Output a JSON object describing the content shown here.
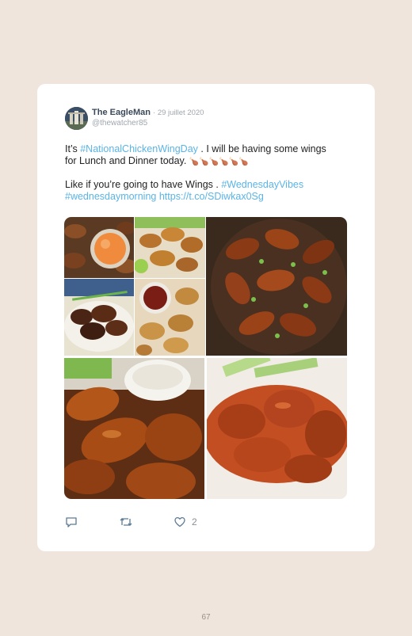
{
  "tweet": {
    "author_name": "The EagleMan",
    "date": "· 29 juillet 2020",
    "handle": "@thewatcher85",
    "line1_prefix": "It’s ",
    "line1_hashtag": "#NationalChickenWingDay",
    "line1_suffix": " . I will be having some wings",
    "line2": "for Lunch and Dinner today.",
    "line2_emoji": "🍗🍗🍗🍗🍗🍗",
    "line3_prefix": "Like if you’re going to have Wings . ",
    "line3_hashtag": "#WednesdayVibes",
    "line4_hashtag": "#wednesdaymorning",
    "line4_link": "https://t.co/SDiwkax0Sg",
    "like_count": "2"
  },
  "media": [
    {
      "name": "wings-with-dip-small-1"
    },
    {
      "name": "fried-wings-small-2"
    },
    {
      "name": "glazed-wings-skillet"
    },
    {
      "name": "wings-on-plate-small-3"
    },
    {
      "name": "wings-with-sauce-small-4"
    },
    {
      "name": "honey-glazed-wings-with-ranch"
    },
    {
      "name": "buffalo-wings-with-celery"
    }
  ],
  "icons": {
    "reply": "reply-icon",
    "retweet": "retweet-icon",
    "like": "heart-icon"
  },
  "page_number": "67",
  "colors": {
    "background": "#efe5dc",
    "card": "#ffffff",
    "hashtag": "#5ab4e6",
    "name": "#3b4a5a",
    "muted": "#a0a6ad"
  }
}
